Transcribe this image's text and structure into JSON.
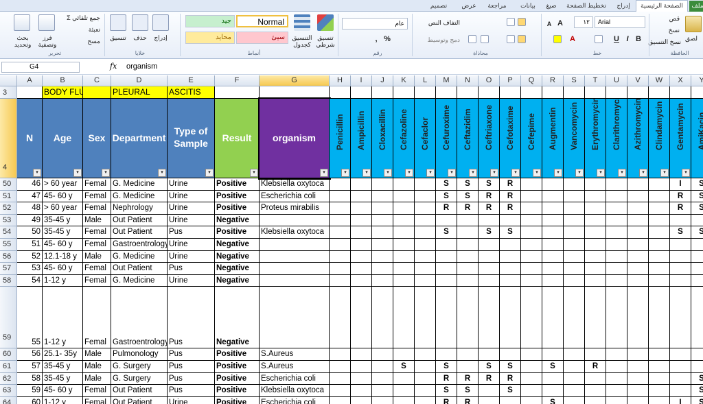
{
  "ribbon": {
    "tabs": [
      "ملف",
      "الصفحة الرئيسية",
      "إدراج",
      "تخطيط الصفحة",
      "صيغ",
      "بيانات",
      "مراجعة",
      "عرض",
      "تصميم"
    ],
    "clipboard": {
      "paste": "لصق",
      "cut": "قص",
      "copy": "نسخ",
      "format_painter": "نسخ التنسيق",
      "group": "الحافظة"
    },
    "font": {
      "name": "Arial",
      "size": "١٢",
      "bold": "B",
      "italic": "I",
      "underline": "U",
      "group": "خط"
    },
    "alignment": {
      "wrap": "التفاف النص",
      "merge": "دمج وتوسيط",
      "group": "محاذاة"
    },
    "number": {
      "format": "عام",
      "percent": "%",
      "comma": ",",
      "group": "رقم"
    },
    "styles": {
      "conditional": "تنسيق شرطي",
      "format_table": "التنسيق كجدول",
      "normal": "Normal",
      "good": "جيد",
      "bad": "سيئ",
      "neutral": "محايد",
      "group": "أنماط"
    },
    "cells": {
      "insert": "إدراج",
      "delete": "حذف",
      "format": "تنسيق",
      "group": "خلايا"
    },
    "editing": {
      "autosum": "جمع تلقائي",
      "fill": "تعبئة",
      "clear": "مسح",
      "sort": "فرز وتصفية",
      "find": "بحث وتحديد",
      "group": "تحرير"
    },
    "colors": {
      "good_bg": "#c6efce",
      "good_fg": "#006100",
      "bad_bg": "#ffc7ce",
      "bad_fg": "#9c0006",
      "neutral_bg": "#ffeb9c",
      "neutral_fg": "#9c6500"
    }
  },
  "formula_bar": {
    "name_box": "G4",
    "fx": "fx",
    "value": "organism"
  },
  "column_letters": [
    "A",
    "B",
    "C",
    "D",
    "E",
    "F",
    "G",
    "H",
    "I",
    "J",
    "K",
    "L",
    "M",
    "N",
    "O",
    "P",
    "Q",
    "R",
    "S",
    "T",
    "U",
    "V",
    "W",
    "X",
    "Y"
  ],
  "row3": {
    "label": "3",
    "B": "BODY FLUID",
    "D": "PLEURAL",
    "E": "ASCITIS"
  },
  "row4": {
    "label": "4",
    "headers": {
      "A": "N",
      "B": "Age",
      "C": "Sex",
      "D": "Department",
      "E": "Type of Sample",
      "F": "Result",
      "G": "organism"
    },
    "antibiotics": [
      "Penicillin",
      "Ampicillin",
      "Cloxacillin",
      "Cefazoline",
      "Cefaclor",
      "Cefuroxime",
      "Ceftazidim",
      "Ceftriaxone",
      "Cefotaxime",
      "Cefepime",
      "Augmentin",
      "Vancomycin",
      "Erythromycin",
      "Clarithromycin",
      "Azithromycin",
      "Clindamycin",
      "Gentamycin",
      "AmiKacin"
    ]
  },
  "header_colors": {
    "blue": "#4f81bd",
    "green": "#92d050",
    "purple": "#7030a0",
    "cyan": "#00b0f0",
    "yellow": "#ffff00"
  },
  "rows": [
    {
      "r": "50",
      "n": "46",
      "age": "> 60 year",
      "sex": "Femal",
      "dept": "G. Medicine",
      "sample": "Urine",
      "result": "Positive",
      "org": "Klebsiella oxytoca",
      "abx": [
        "",
        "",
        "",
        "",
        "",
        "S",
        "S",
        "S",
        "R",
        "",
        "",
        "",
        "",
        "",
        "",
        "",
        "I",
        "S"
      ]
    },
    {
      "r": "51",
      "n": "47",
      "age": "45- 60 y",
      "sex": "Femal",
      "dept": "G. Medicine",
      "sample": "Urine",
      "result": "Positive",
      "org": "Escherichia coli",
      "abx": [
        "",
        "",
        "",
        "",
        "",
        "S",
        "S",
        "R",
        "R",
        "",
        "",
        "",
        "",
        "",
        "",
        "",
        "R",
        "S"
      ]
    },
    {
      "r": "52",
      "n": "48",
      "age": "> 60 year",
      "sex": "Femal",
      "dept": "Nephrology",
      "sample": "Urine",
      "result": "Positive",
      "org": "Proteus mirabilis",
      "abx": [
        "",
        "",
        "",
        "",
        "",
        "R",
        "R",
        "R",
        "R",
        "",
        "",
        "",
        "",
        "",
        "",
        "",
        "R",
        "S"
      ]
    },
    {
      "r": "53",
      "n": "49",
      "age": "35-45 y",
      "sex": "Male",
      "dept": "Out Patient",
      "sample": "Urine",
      "result": "Negative",
      "org": "",
      "abx": [
        "",
        "",
        "",
        "",
        "",
        "",
        "",
        "",
        "",
        "",
        "",
        "",
        "",
        "",
        "",
        "",
        "",
        ""
      ]
    },
    {
      "r": "54",
      "n": "50",
      "age": "35-45 y",
      "sex": "Femal",
      "dept": "Out Patient",
      "sample": "Pus",
      "result": "Positive",
      "org": "Klebsiella oxytoca",
      "abx": [
        "",
        "",
        "",
        "",
        "",
        "S",
        "",
        "S",
        "S",
        "",
        "",
        "",
        "",
        "",
        "",
        "",
        "S",
        "S"
      ]
    },
    {
      "r": "55",
      "n": "51",
      "age": "45- 60 y",
      "sex": "Femal",
      "dept": "Gastroentrology",
      "sample": "Urine",
      "result": "Negative",
      "org": "",
      "abx": [
        "",
        "",
        "",
        "",
        "",
        "",
        "",
        "",
        "",
        "",
        "",
        "",
        "",
        "",
        "",
        "",
        "",
        ""
      ]
    },
    {
      "r": "56",
      "n": "52",
      "age": "12.1-18 y",
      "sex": "Male",
      "dept": "G. Medicine",
      "sample": "Urine",
      "result": "Negative",
      "org": "",
      "abx": [
        "",
        "",
        "",
        "",
        "",
        "",
        "",
        "",
        "",
        "",
        "",
        "",
        "",
        "",
        "",
        "",
        "",
        ""
      ]
    },
    {
      "r": "57",
      "n": "53",
      "age": "45- 60 y",
      "sex": "Femal",
      "dept": "Out Patient",
      "sample": "Pus",
      "result": "Negative",
      "org": "",
      "abx": [
        "",
        "",
        "",
        "",
        "",
        "",
        "",
        "",
        "",
        "",
        "",
        "",
        "",
        "",
        "",
        "",
        "",
        ""
      ]
    },
    {
      "r": "58",
      "n": "54",
      "age": "1-12 y",
      "sex": "Femal",
      "dept": "G. Medicine",
      "sample": "Urine",
      "result": "Negative",
      "org": "",
      "abx": [
        "",
        "",
        "",
        "",
        "",
        "",
        "",
        "",
        "",
        "",
        "",
        "",
        "",
        "",
        "",
        "",
        "",
        ""
      ]
    },
    {
      "r": "59",
      "n": "55",
      "age": "1-12 y",
      "sex": "Femal",
      "dept": "Gastroentrology",
      "sample": "Pus",
      "result": "Negative",
      "org": "",
      "abx": [
        "",
        "",
        "",
        "",
        "",
        "",
        "",
        "",
        "",
        "",
        "",
        "",
        "",
        "",
        "",
        "",
        "",
        ""
      ]
    },
    {
      "r": "60",
      "n": "56",
      "age": "25.1- 35y",
      "sex": "Male",
      "dept": "Pulmonology",
      "sample": "Pus",
      "result": "Positive",
      "org": "S.Aureus",
      "abx": [
        "",
        "",
        "",
        "",
        "",
        "",
        "",
        "",
        "",
        "",
        "",
        "",
        "",
        "",
        "",
        "",
        "",
        ""
      ]
    },
    {
      "r": "61",
      "n": "57",
      "age": "35-45 y",
      "sex": "Male",
      "dept": "G. Surgery",
      "sample": "Pus",
      "result": "Positive",
      "org": "S.Aureus",
      "abx": [
        "",
        "",
        "",
        "S",
        "",
        "S",
        "",
        "S",
        "S",
        "",
        "S",
        "",
        "R",
        "",
        "",
        "",
        "",
        ""
      ]
    },
    {
      "r": "62",
      "n": "58",
      "age": "35-45 y",
      "sex": "Male",
      "dept": "G. Surgery",
      "sample": "Pus",
      "result": "Positive",
      "org": "Escherichia coli",
      "abx": [
        "",
        "",
        "",
        "",
        "",
        "R",
        "R",
        "R",
        "R",
        "",
        "",
        "",
        "",
        "",
        "",
        "",
        "",
        "S"
      ]
    },
    {
      "r": "63",
      "n": "59",
      "age": "45- 60 y",
      "sex": "Femal",
      "dept": "Out Patient",
      "sample": "Pus",
      "result": "Positive",
      "org": "Klebsiella oxytoca",
      "abx": [
        "",
        "",
        "",
        "",
        "",
        "S",
        "S",
        "",
        "S",
        "",
        "",
        "",
        "",
        "",
        "",
        "",
        "",
        "S"
      ]
    },
    {
      "r": "64",
      "n": "60",
      "age": "1-12 y",
      "sex": "Femal",
      "dept": "Out Patient",
      "sample": "Urine",
      "result": "Positive",
      "org": "Escherichia coli",
      "abx": [
        "",
        "",
        "",
        "",
        "",
        "R",
        "R",
        "",
        "",
        "",
        "S",
        "",
        "",
        "",
        "",
        "",
        "I",
        "S"
      ]
    }
  ]
}
